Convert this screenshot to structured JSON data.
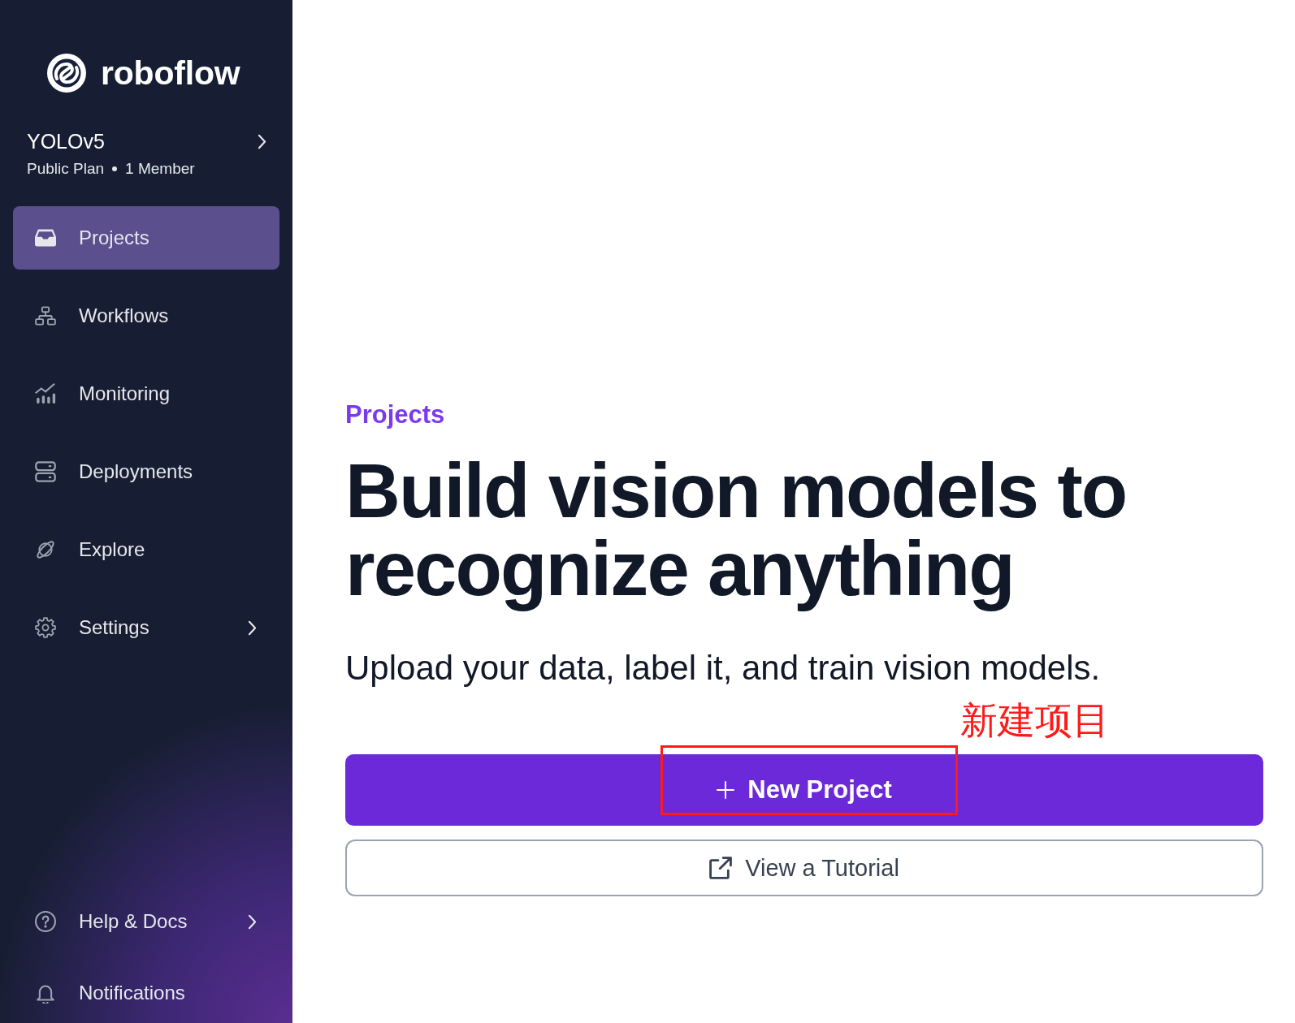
{
  "sidebar": {
    "logo": "roboflow",
    "workspace": {
      "name": "YOLOv5",
      "plan": "Public Plan",
      "members": "1 Member"
    },
    "nav": [
      {
        "label": "Projects",
        "selected": true,
        "submenu": false
      },
      {
        "label": "Workflows",
        "selected": false,
        "submenu": false
      },
      {
        "label": "Monitoring",
        "selected": false,
        "submenu": false
      },
      {
        "label": "Deployments",
        "selected": false,
        "submenu": false
      },
      {
        "label": "Explore",
        "selected": false,
        "submenu": false
      },
      {
        "label": "Settings",
        "selected": false,
        "submenu": true
      }
    ],
    "footer_nav": [
      {
        "label": "Help & Docs",
        "selected": false,
        "submenu": true
      },
      {
        "label": "Notifications",
        "selected": false,
        "submenu": false
      }
    ]
  },
  "main": {
    "section_label": "Projects",
    "headline": "Build vision models to recognize anything",
    "subtitle": "Upload your data, label it, and train vision models.",
    "primary_button": "New Project",
    "secondary_button": "View a Tutorial"
  },
  "annotation": {
    "label": "新建项目"
  }
}
